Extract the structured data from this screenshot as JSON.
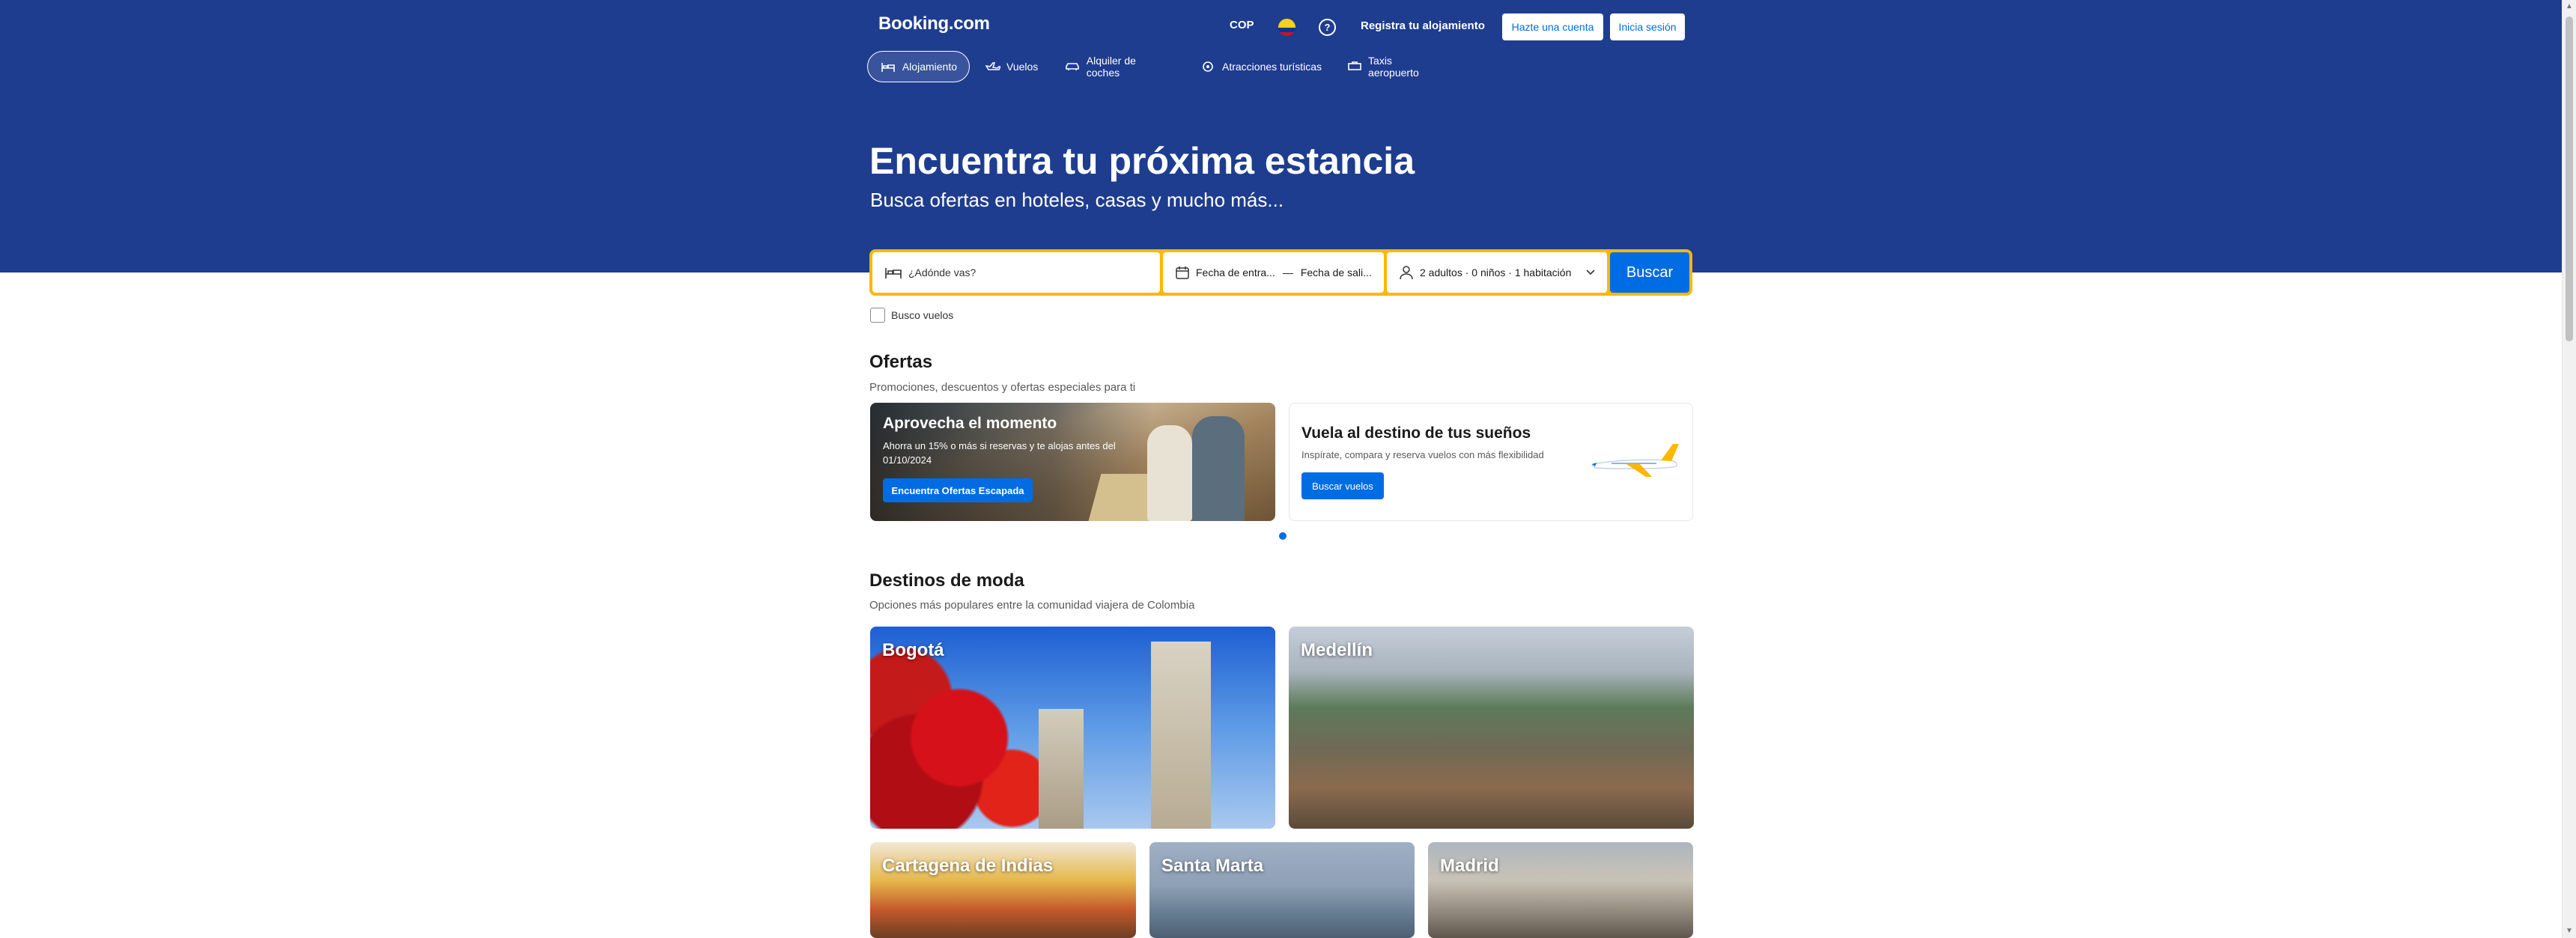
{
  "header": {
    "logo": "Booking.com",
    "currency": "COP",
    "register_label": "Registra tu alojamiento",
    "signup_label": "Hazte una cuenta",
    "signin_label": "Inicia sesión"
  },
  "nav": {
    "items": [
      {
        "label": "Alojamiento",
        "icon": "bed-icon",
        "active": true
      },
      {
        "label": "Vuelos",
        "icon": "plane-icon"
      },
      {
        "label": "Alquiler de coches",
        "icon": "car-icon"
      },
      {
        "label": "Atracciones turísticas",
        "icon": "attractions-icon"
      },
      {
        "label": "Taxis aeropuerto",
        "icon": "taxi-icon"
      }
    ]
  },
  "hero": {
    "title": "Encuentra tu próxima estancia",
    "subtitle": "Busca ofertas en hoteles, casas y mucho más..."
  },
  "search": {
    "destination_placeholder": "¿Adónde vas?",
    "checkin": "Fecha de entra...",
    "separator": "—",
    "checkout": "Fecha de sali...",
    "guests": "2 adultos · 0 niños · 1 habitación",
    "button": "Buscar",
    "flights_checkbox": "Busco vuelos"
  },
  "offers": {
    "title": "Ofertas",
    "subtitle": "Promociones, descuentos y ofertas especiales para ti",
    "cards": [
      {
        "title": "Aprovecha el momento",
        "text": "Ahorra un 15% o más si reservas y te alojas antes del 01/10/2024",
        "button": "Encuentra Ofertas Escapada"
      },
      {
        "title": "Vuela al destino de tus sueños",
        "text": "Inspírate, compara y reserva vuelos con más flexibilidad",
        "button": "Buscar vuelos"
      }
    ]
  },
  "trending": {
    "title": "Destinos de moda",
    "subtitle": "Opciones más populares entre la comunidad viajera de Colombia",
    "destinations": [
      "Bogotá",
      "Medellín",
      "Cartagena de Indias",
      "Santa Marta",
      "Madrid"
    ]
  },
  "colors": {
    "brand_blue": "#1e3d8f",
    "accent_blue": "#006ce4",
    "search_border": "#ffb700"
  }
}
